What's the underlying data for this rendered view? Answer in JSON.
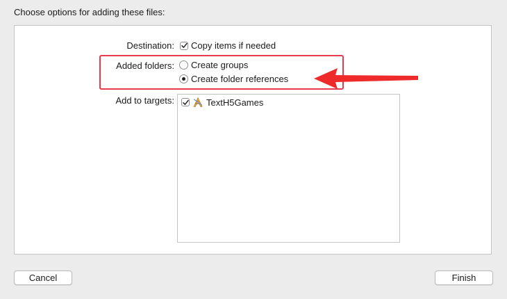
{
  "dialog": {
    "title": "Choose options for adding these files:"
  },
  "destination": {
    "label": "Destination:",
    "copy_items": {
      "label": "Copy items if needed",
      "checked": true
    }
  },
  "added_folders": {
    "label": "Added folders:",
    "options": [
      {
        "label": "Create groups",
        "selected": false
      },
      {
        "label": "Create folder references",
        "selected": true
      }
    ]
  },
  "targets": {
    "label": "Add to targets:",
    "items": [
      {
        "label": "TextH5Games",
        "checked": true,
        "icon": "xcode-app-icon"
      }
    ]
  },
  "buttons": {
    "cancel": "Cancel",
    "finish": "Finish"
  },
  "annotation": {
    "highlight_color": "#e8394d",
    "arrow_color": "#ee2a2a"
  }
}
